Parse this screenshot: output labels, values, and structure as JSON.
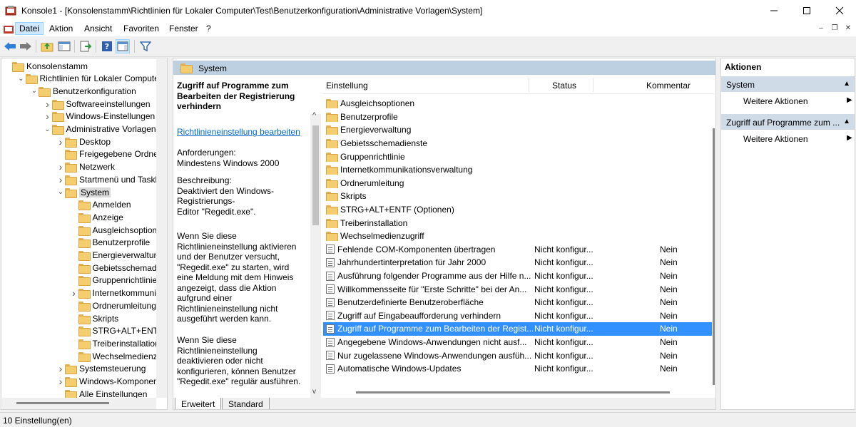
{
  "window": {
    "title": "Konsole1 - [Konsolenstamm\\Richtlinien für Lokaler Computer\\Test\\Benutzerkonfiguration\\Administrative Vorlagen\\System]"
  },
  "menu": [
    "Datei",
    "Aktion",
    "Ansicht",
    "Favoriten",
    "Fenster",
    "?"
  ],
  "tree": {
    "items": [
      {
        "label": "Konsolenstamm",
        "level": 0,
        "exp": ""
      },
      {
        "label": "Richtlinien für Lokaler Computer\\",
        "level": 1,
        "exp": "v"
      },
      {
        "label": "Benutzerkonfiguration",
        "level": 2,
        "exp": "v"
      },
      {
        "label": "Softwareeinstellungen",
        "level": 3,
        "exp": ">"
      },
      {
        "label": "Windows-Einstellungen",
        "level": 3,
        "exp": ">"
      },
      {
        "label": "Administrative Vorlagen",
        "level": 3,
        "exp": "v"
      },
      {
        "label": "Desktop",
        "level": 4,
        "exp": ">"
      },
      {
        "label": "Freigegebene Ordner",
        "level": 4,
        "exp": ""
      },
      {
        "label": "Netzwerk",
        "level": 4,
        "exp": ">"
      },
      {
        "label": "Startmenü und Taskleis",
        "level": 4,
        "exp": ">"
      },
      {
        "label": "System",
        "level": 4,
        "exp": "v",
        "selected": true
      },
      {
        "label": "Anmelden",
        "level": 5,
        "exp": ""
      },
      {
        "label": "Anzeige",
        "level": 5,
        "exp": ""
      },
      {
        "label": "Ausgleichsoptioner",
        "level": 5,
        "exp": ""
      },
      {
        "label": "Benutzerprofile",
        "level": 5,
        "exp": ""
      },
      {
        "label": "Energieverwaltung",
        "level": 5,
        "exp": ""
      },
      {
        "label": "Gebietsschemadien",
        "level": 5,
        "exp": ""
      },
      {
        "label": "Gruppenrichtlinie",
        "level": 5,
        "exp": ""
      },
      {
        "label": "Internetkommunika",
        "level": 5,
        "exp": ">"
      },
      {
        "label": "Ordnerumleitung",
        "level": 5,
        "exp": ""
      },
      {
        "label": "Skripts",
        "level": 5,
        "exp": ""
      },
      {
        "label": "STRG+ALT+ENTF (C",
        "level": 5,
        "exp": ""
      },
      {
        "label": "Treiberinstallation",
        "level": 5,
        "exp": ""
      },
      {
        "label": "Wechselmedienzug",
        "level": 5,
        "exp": ""
      },
      {
        "label": "Systemsteuerung",
        "level": 4,
        "exp": ">"
      },
      {
        "label": "Windows-Komponente",
        "level": 4,
        "exp": ">"
      },
      {
        "label": "Alle Einstellungen",
        "level": 4,
        "exp": ""
      }
    ]
  },
  "middle": {
    "header": "System",
    "description": {
      "title": "Zugriff auf Programme zum Bearbeiten der Registrierung verhindern",
      "link": "Richtlinieneinstellung bearbeiten",
      "requirements": "Anforderungen:\nMindestens Windows 2000",
      "description": "Beschreibung:\nDeaktiviert den Windows-Registrierungs-\nEditor \"Regedit.exe\".",
      "enabled": "Wenn Sie diese Richtlinieneinstellung aktivieren und der Benutzer versucht, \"Regedit.exe\" zu starten, wird eine Meldung mit dem Hinweis angezeigt, dass die Aktion aufgrund einer Richtlinieneinstellung nicht ausgeführt werden kann.",
      "disabled": "Wenn Sie diese Richtlinieneinstellung deaktivieren oder nicht konfigurieren, können Benutzer \"Regedit.exe\" regulär ausführen."
    },
    "columns": [
      "Einstellung",
      "Status",
      "Kommentar"
    ],
    "folders": [
      "Ausgleichsoptionen",
      "Benutzerprofile",
      "Energieverwaltung",
      "Gebietsschemadienste",
      "Gruppenrichtlinie",
      "Internetkommunikationsverwaltung",
      "Ordnerumleitung",
      "Skripts",
      "STRG+ALT+ENTF (Optionen)",
      "Treiberinstallation",
      "Wechselmedienzugriff"
    ],
    "settings": [
      {
        "name": "Fehlende COM-Komponenten übertragen",
        "status": "Nicht konfigur...",
        "comment": "Nein"
      },
      {
        "name": "Jahrhundertinterpretation für Jahr 2000",
        "status": "Nicht konfigur...",
        "comment": "Nein"
      },
      {
        "name": "Ausführung folgender Programme aus der Hilfe n...",
        "status": "Nicht konfigur...",
        "comment": "Nein"
      },
      {
        "name": "Willkommensseite für \"Erste Schritte\" bei der An...",
        "status": "Nicht konfigur...",
        "comment": "Nein"
      },
      {
        "name": "Benutzerdefinierte Benutzeroberfläche",
        "status": "Nicht konfigur...",
        "comment": "Nein"
      },
      {
        "name": "Zugriff auf Eingabeaufforderung verhindern",
        "status": "Nicht konfigur...",
        "comment": "Nein"
      },
      {
        "name": "Zugriff auf Programme zum Bearbeiten der Regist...",
        "status": "Nicht konfigur...",
        "comment": "Nein",
        "selected": true
      },
      {
        "name": "Angegebene Windows-Anwendungen nicht ausf...",
        "status": "Nicht konfigur...",
        "comment": "Nein"
      },
      {
        "name": "Nur zugelassene Windows-Anwendungen ausfüh...",
        "status": "Nicht konfigur...",
        "comment": "Nein"
      },
      {
        "name": "Automatische Windows-Updates",
        "status": "Nicht konfigur...",
        "comment": "Nein"
      }
    ],
    "tabs": [
      "Erweitert",
      "Standard"
    ]
  },
  "actions": {
    "header": "Aktionen",
    "sections": [
      {
        "title": "System",
        "item": "Weitere Aktionen"
      },
      {
        "title": "Zugriff auf Programme zum ...",
        "item": "Weitere Aktionen"
      }
    ]
  },
  "status": "10 Einstellung(en)",
  "colors": {
    "selection": "#3390ff",
    "header": "#bdd0e2",
    "section": "#d0dbe8",
    "folder": "#f4cd6e",
    "link": "#0066cc"
  }
}
